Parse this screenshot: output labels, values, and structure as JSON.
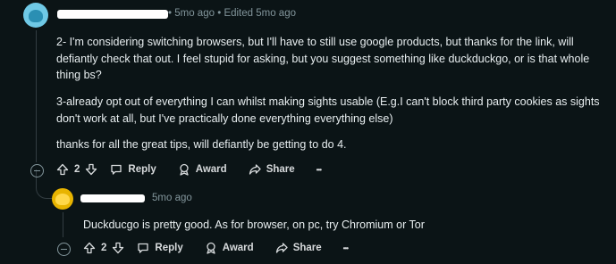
{
  "comment1": {
    "separator": "•",
    "time": "5mo ago",
    "separator2": "•",
    "edited": "Edited 5mo ago",
    "paragraphs": [
      "2- I'm considering switching browsers, but I'll have to still use google products, but thanks for the link, will defiantly check that out. I feel stupid for asking, but you suggest something like duckduckgo, or is that whole thing bs?",
      "3-already opt out of everything I can whilst making sights usable (E.g.I can't block third party cookies as sights don't work at all, but I've practically done everything everything else)",
      "thanks for all the great tips, will defiantly be getting to do 4."
    ],
    "actions": {
      "votes": "2",
      "reply": "Reply",
      "award": "Award",
      "share": "Share",
      "more": "•••"
    }
  },
  "comment2": {
    "time": "5mo ago",
    "text": "Duckducgo is pretty good. As for browser, on pc, try Chromium or Tor",
    "actions": {
      "votes": "2",
      "reply": "Reply",
      "award": "Award",
      "share": "Share",
      "more": "•••"
    }
  },
  "colors": {
    "background": "#0b1416",
    "text": "#e8eef0",
    "meta": "#82959b",
    "avatar1": "#6fc9e6",
    "avatar2": "#e8b400"
  },
  "icons": [
    "upvote-icon",
    "downvote-icon",
    "reply-icon",
    "award-icon",
    "share-icon",
    "more-icon",
    "collapse-icon"
  ]
}
